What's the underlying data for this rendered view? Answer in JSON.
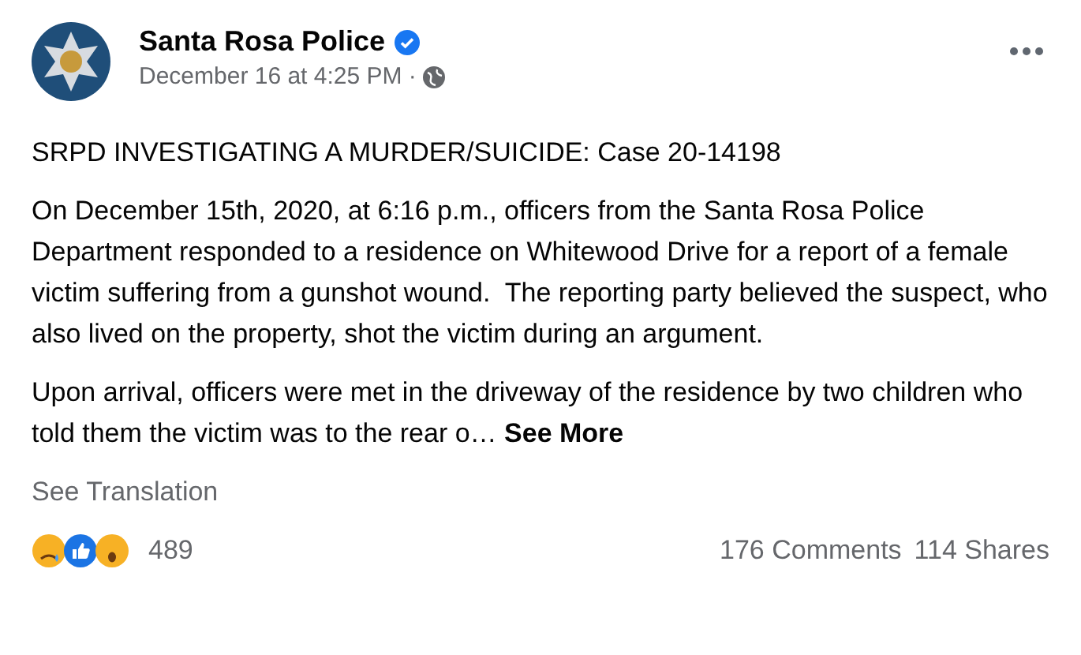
{
  "post": {
    "author": "Santa Rosa Police",
    "verified": true,
    "timestamp": "December 16 at 4:25 PM ·",
    "headline": "SRPD INVESTIGATING A MURDER/SUICIDE: Case 20-14198",
    "paragraphs": [
      "On December 15th, 2020, at 6:16 p.m., officers from the Santa Rosa Police Department responded to a residence on Whitewood Drive for a report of a female victim suffering from a gunshot wound.  The reporting party believed the suspect, who also lived on the property, shot the victim during an argument.",
      "Upon arrival, officers were met in the driveway of the residence by two children who told them the victim was to the rear o…"
    ],
    "see_more": "See More",
    "see_translation": "See Translation"
  },
  "reactions": {
    "count": "489",
    "types": [
      {
        "kind": "sad"
      },
      {
        "kind": "like"
      },
      {
        "kind": "wow"
      }
    ]
  },
  "stats": {
    "comments": "176 Comments",
    "shares": "114 Shares"
  }
}
